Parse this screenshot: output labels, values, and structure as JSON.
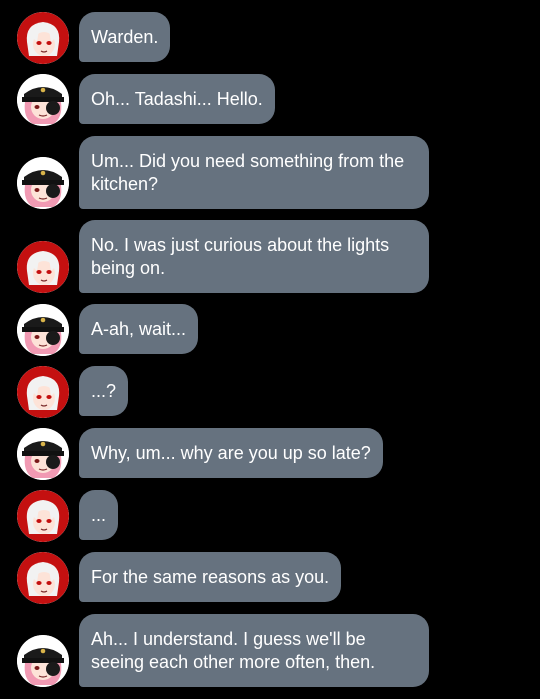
{
  "conversation": {
    "speakers": {
      "warden": {
        "avatar_icon": "warden-avatar-icon",
        "bg_color": "#c41010",
        "hair_color": "#f2f2f2"
      },
      "tadashi": {
        "avatar_icon": "tadashi-avatar-icon",
        "bg_color": "#1a1a1a",
        "hair_color": "#f19ab3"
      }
    },
    "bubble_color": "#66727f",
    "text_color": "#ffffff",
    "messages": [
      {
        "speaker": "warden",
        "text": "Warden."
      },
      {
        "speaker": "tadashi",
        "text": "Oh... Tadashi... Hello."
      },
      {
        "speaker": "tadashi",
        "text": "Um... Did you need something from the kitchen?"
      },
      {
        "speaker": "warden",
        "text": "No. I was just curious about the lights being on."
      },
      {
        "speaker": "tadashi",
        "text": "A-ah, wait..."
      },
      {
        "speaker": "warden",
        "text": "...?"
      },
      {
        "speaker": "tadashi",
        "text": "Why, um... why are you up so late?"
      },
      {
        "speaker": "warden",
        "text": "..."
      },
      {
        "speaker": "warden",
        "text": "For the same reasons as you."
      },
      {
        "speaker": "tadashi",
        "text": "Ah... I understand. I guess we'll be seeing each other more often, then."
      }
    ]
  }
}
